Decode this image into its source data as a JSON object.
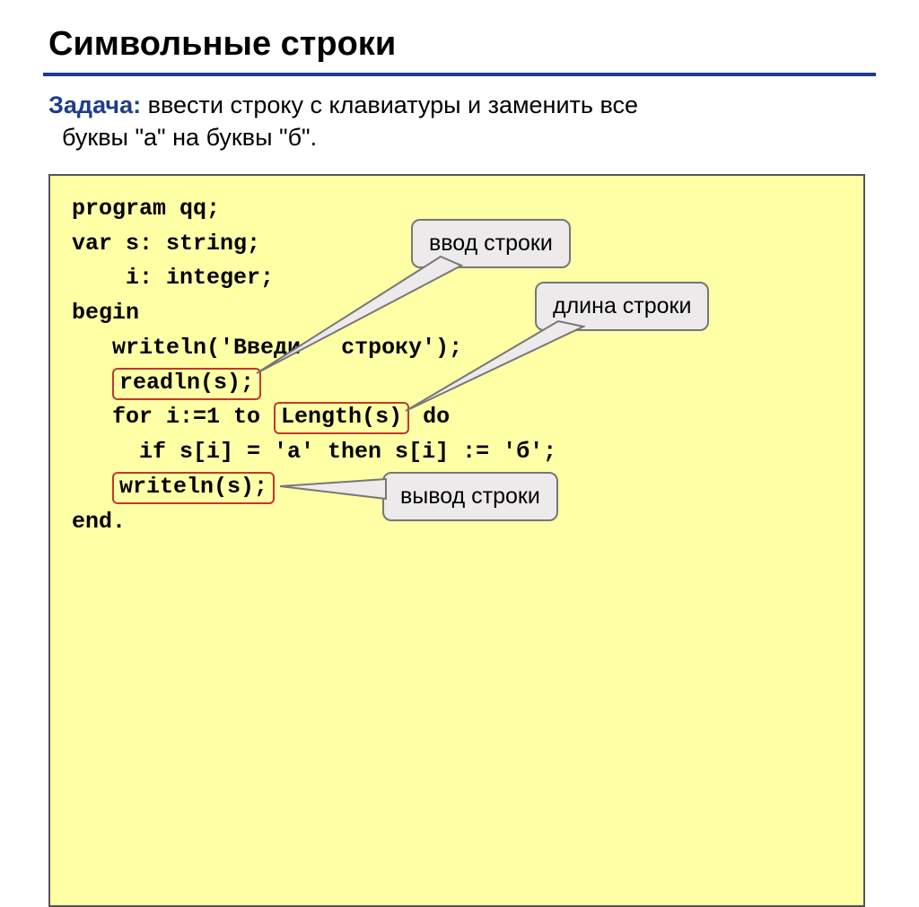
{
  "title": "Символьные строки",
  "task_label": "Задача:",
  "task_text_1": " ввести строку с клавиатуры и заменить все",
  "task_text_2": "буквы \"а\" на буквы \"б\".",
  "code": {
    "l1": "program qq;",
    "l2": "var s: string;",
    "l3": "    i: integer;",
    "l4": "begin",
    "l5_a": "   writeln('Введи",
    "l5_b": " строку');",
    "l6": "readln(s);",
    "l7_a": "   for i:=1 to ",
    "l7_b": "Length(s)",
    "l7_c": " do",
    "l8": "     if s[i] = 'а' then s[i] := 'б';",
    "l9": "writeln(s);",
    "l10": "end."
  },
  "callouts": {
    "input": "ввод строки",
    "length": "длина строки",
    "output": "вывод строки"
  }
}
